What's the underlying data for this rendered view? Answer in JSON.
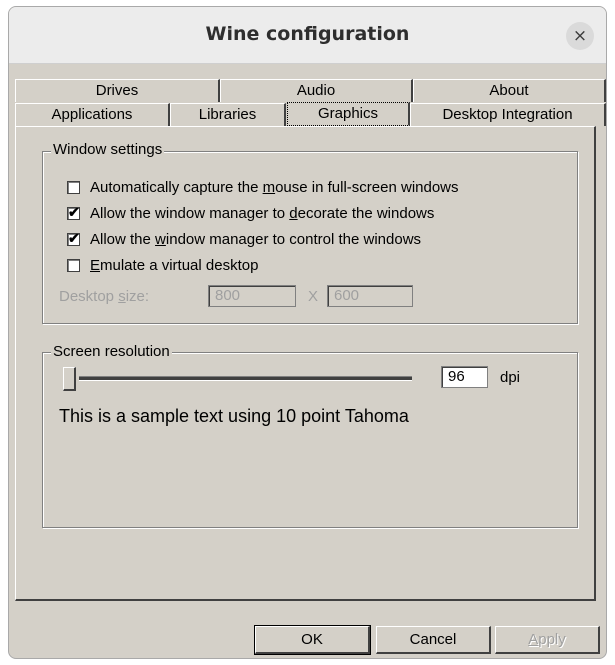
{
  "window": {
    "title": "Wine configuration",
    "close_glyph": "×"
  },
  "tabs": {
    "row1": [
      "Drives",
      "Audio",
      "About"
    ],
    "row2": [
      "Applications",
      "Libraries",
      "Graphics",
      "Desktop Integration"
    ],
    "active": "Graphics"
  },
  "window_settings": {
    "legend": "Window settings",
    "capture_mouse": {
      "pre": "Automatically capture the ",
      "u": "m",
      "post": "ouse in full-screen windows",
      "checked": false
    },
    "decorate": {
      "pre": "Allow the window manager to ",
      "u": "d",
      "post": "ecorate the windows",
      "checked": true
    },
    "control": {
      "pre": "Allow the ",
      "u": "w",
      "post": "indow manager to control the windows",
      "checked": true
    },
    "virtual_desktop": {
      "pre": "",
      "u": "E",
      "post": "mulate a virtual desktop",
      "checked": false
    },
    "desktop_size": {
      "pre": "Desktop ",
      "u": "s",
      "post": "ize:",
      "width": "800",
      "x": "X",
      "height": "600"
    }
  },
  "screen_resolution": {
    "legend": "Screen resolution",
    "dpi_value": "96",
    "dpi_unit": "dpi",
    "sample_text": "This is a sample text using 10 point Tahoma"
  },
  "buttons": {
    "ok": "OK",
    "cancel": "Cancel",
    "apply_u": "A",
    "apply_post": "pply"
  },
  "check_glyph": "✔"
}
